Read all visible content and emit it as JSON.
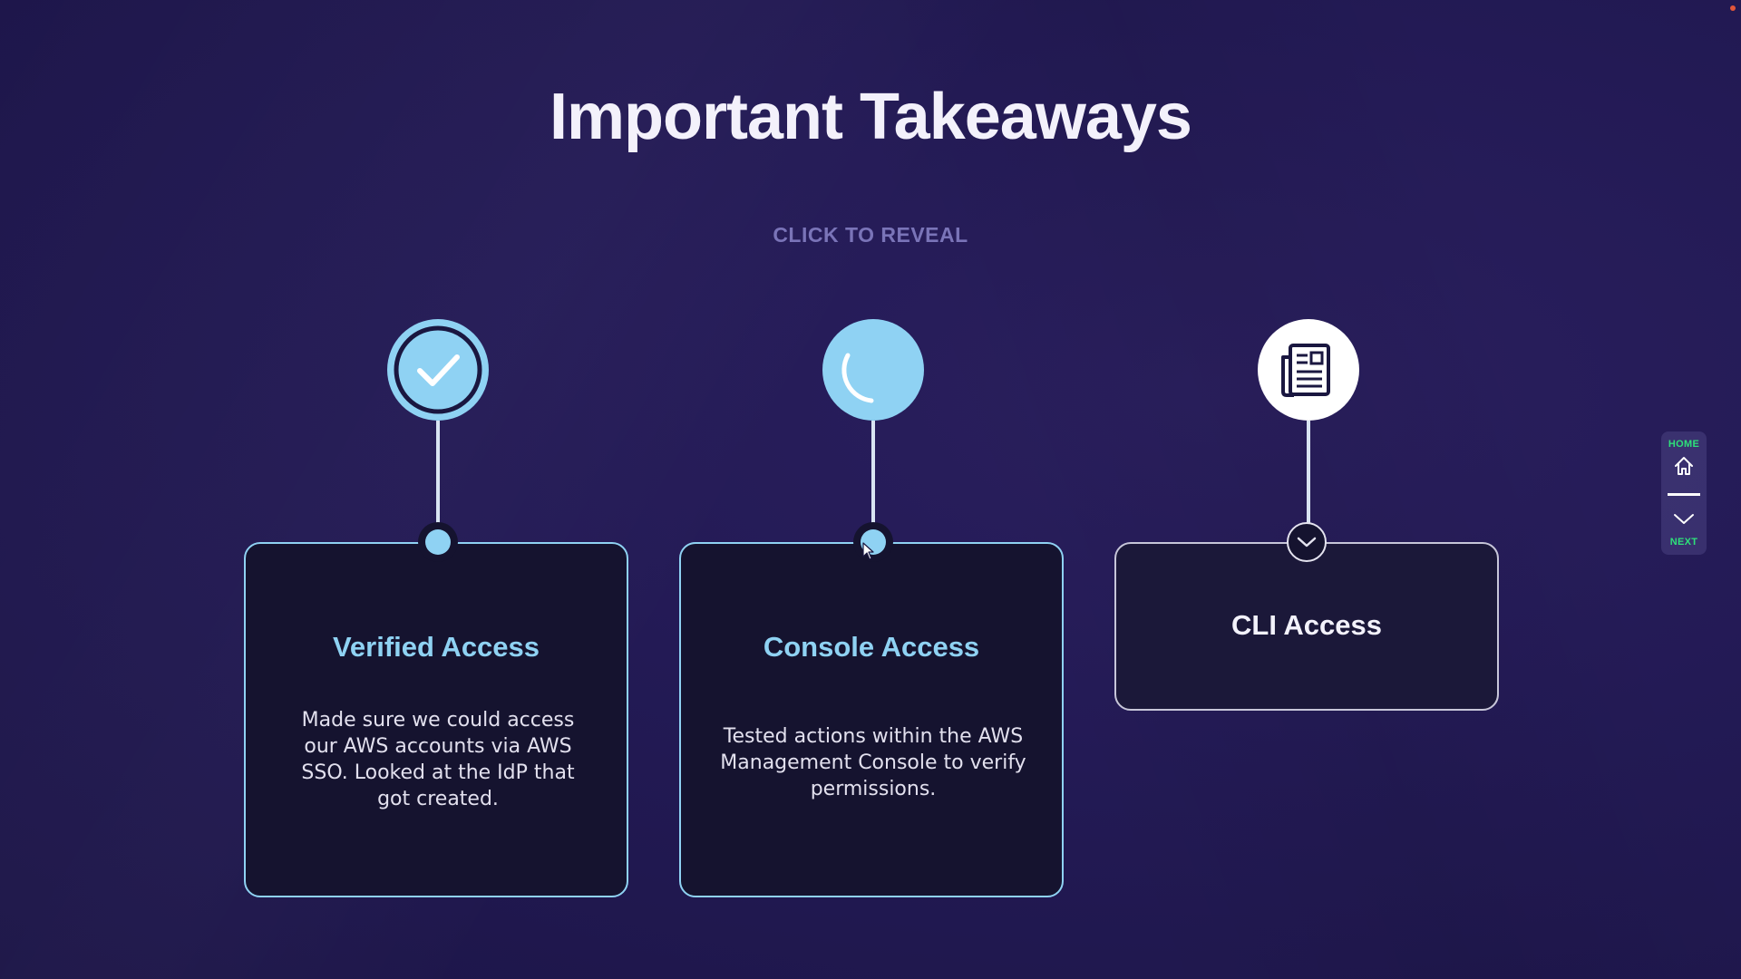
{
  "header": {
    "title": "Important Takeaways",
    "instruction": "CLICK TO REVEAL"
  },
  "items": [
    {
      "title": "Verified Access",
      "text": "Made sure we could access our AWS accounts via AWS SSO. Looked at the IdP that got created.",
      "icon": "checkmark-icon",
      "state": "revealed"
    },
    {
      "title": "Console Access",
      "text": "Tested actions within the AWS Management Console to verify permissions.",
      "icon": "loading-icon",
      "state": "revealed"
    },
    {
      "title": "CLI Access",
      "text": "",
      "icon": "document-icon",
      "state": "collapsed"
    }
  ],
  "nav": {
    "home_label": "HOME",
    "next_label": "NEXT"
  },
  "colors": {
    "accent": "#8fd2f3",
    "background": "#231a55",
    "card": "#15132f",
    "nav_label": "#2ee07a",
    "muted": "#7a74b8"
  }
}
